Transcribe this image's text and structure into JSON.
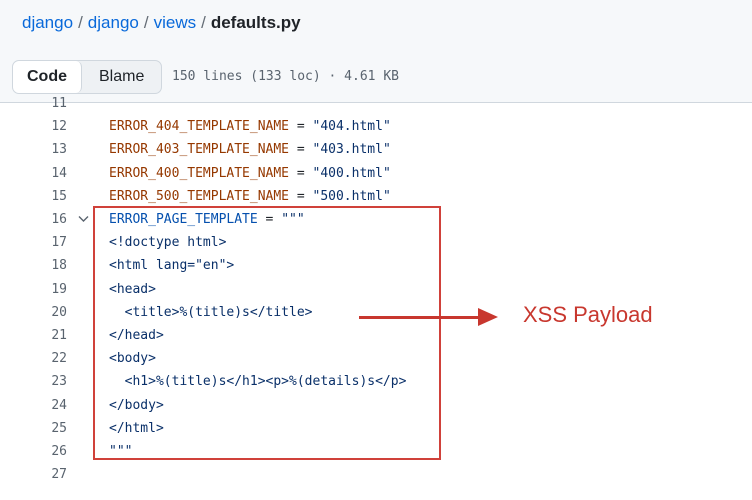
{
  "breadcrumb": {
    "repo": "django",
    "dir1": "django",
    "dir2": "views",
    "file": "defaults.py",
    "separator": "/"
  },
  "toolbar": {
    "code_label": "Code",
    "blame_label": "Blame",
    "file_info": "150 lines (133 loc) · 4.61 KB"
  },
  "code": {
    "lines": [
      {
        "num": "11",
        "parts": []
      },
      {
        "num": "12",
        "parts": [
          [
            "var",
            "ERROR_404_TEMPLATE_NAME"
          ],
          [
            "op",
            " = "
          ],
          [
            "str",
            "\"404.html\""
          ]
        ]
      },
      {
        "num": "13",
        "parts": [
          [
            "var",
            "ERROR_403_TEMPLATE_NAME"
          ],
          [
            "op",
            " = "
          ],
          [
            "str",
            "\"403.html\""
          ]
        ]
      },
      {
        "num": "14",
        "parts": [
          [
            "var",
            "ERROR_400_TEMPLATE_NAME"
          ],
          [
            "op",
            " = "
          ],
          [
            "str",
            "\"400.html\""
          ]
        ]
      },
      {
        "num": "15",
        "parts": [
          [
            "var",
            "ERROR_500_TEMPLATE_NAME"
          ],
          [
            "op",
            " = "
          ],
          [
            "str",
            "\"500.html\""
          ]
        ]
      },
      {
        "num": "16",
        "fold": true,
        "parts": [
          [
            "var2",
            "ERROR_PAGE_TEMPLATE"
          ],
          [
            "op",
            " = "
          ],
          [
            "str",
            "\"\"\""
          ]
        ]
      },
      {
        "num": "17",
        "parts": [
          [
            "str",
            "<!doctype html>"
          ]
        ]
      },
      {
        "num": "18",
        "parts": [
          [
            "str",
            "<html lang=\"en\">"
          ]
        ]
      },
      {
        "num": "19",
        "parts": [
          [
            "str",
            "<head>"
          ]
        ]
      },
      {
        "num": "20",
        "parts": [
          [
            "str",
            "  <title>%(title)s</title>"
          ]
        ]
      },
      {
        "num": "21",
        "parts": [
          [
            "str",
            "</head>"
          ]
        ]
      },
      {
        "num": "22",
        "parts": [
          [
            "str",
            "<body>"
          ]
        ]
      },
      {
        "num": "23",
        "parts": [
          [
            "str",
            "  <h1>%(title)s</h1><p>%(details)s</p>"
          ]
        ]
      },
      {
        "num": "24",
        "parts": [
          [
            "str",
            "</body>"
          ]
        ]
      },
      {
        "num": "25",
        "parts": [
          [
            "str",
            "</html>"
          ]
        ]
      },
      {
        "num": "26",
        "parts": [
          [
            "str",
            "\"\"\""
          ]
        ]
      },
      {
        "num": "27",
        "parts": []
      }
    ]
  },
  "annotation": {
    "label": "XSS Payload",
    "color": "#c8372e"
  },
  "icons": {
    "fold": "chevron-down-icon"
  },
  "colors": {
    "link": "#0969da",
    "variable": "#953800",
    "string": "#0a3069",
    "highlight_border": "#d0413a"
  }
}
